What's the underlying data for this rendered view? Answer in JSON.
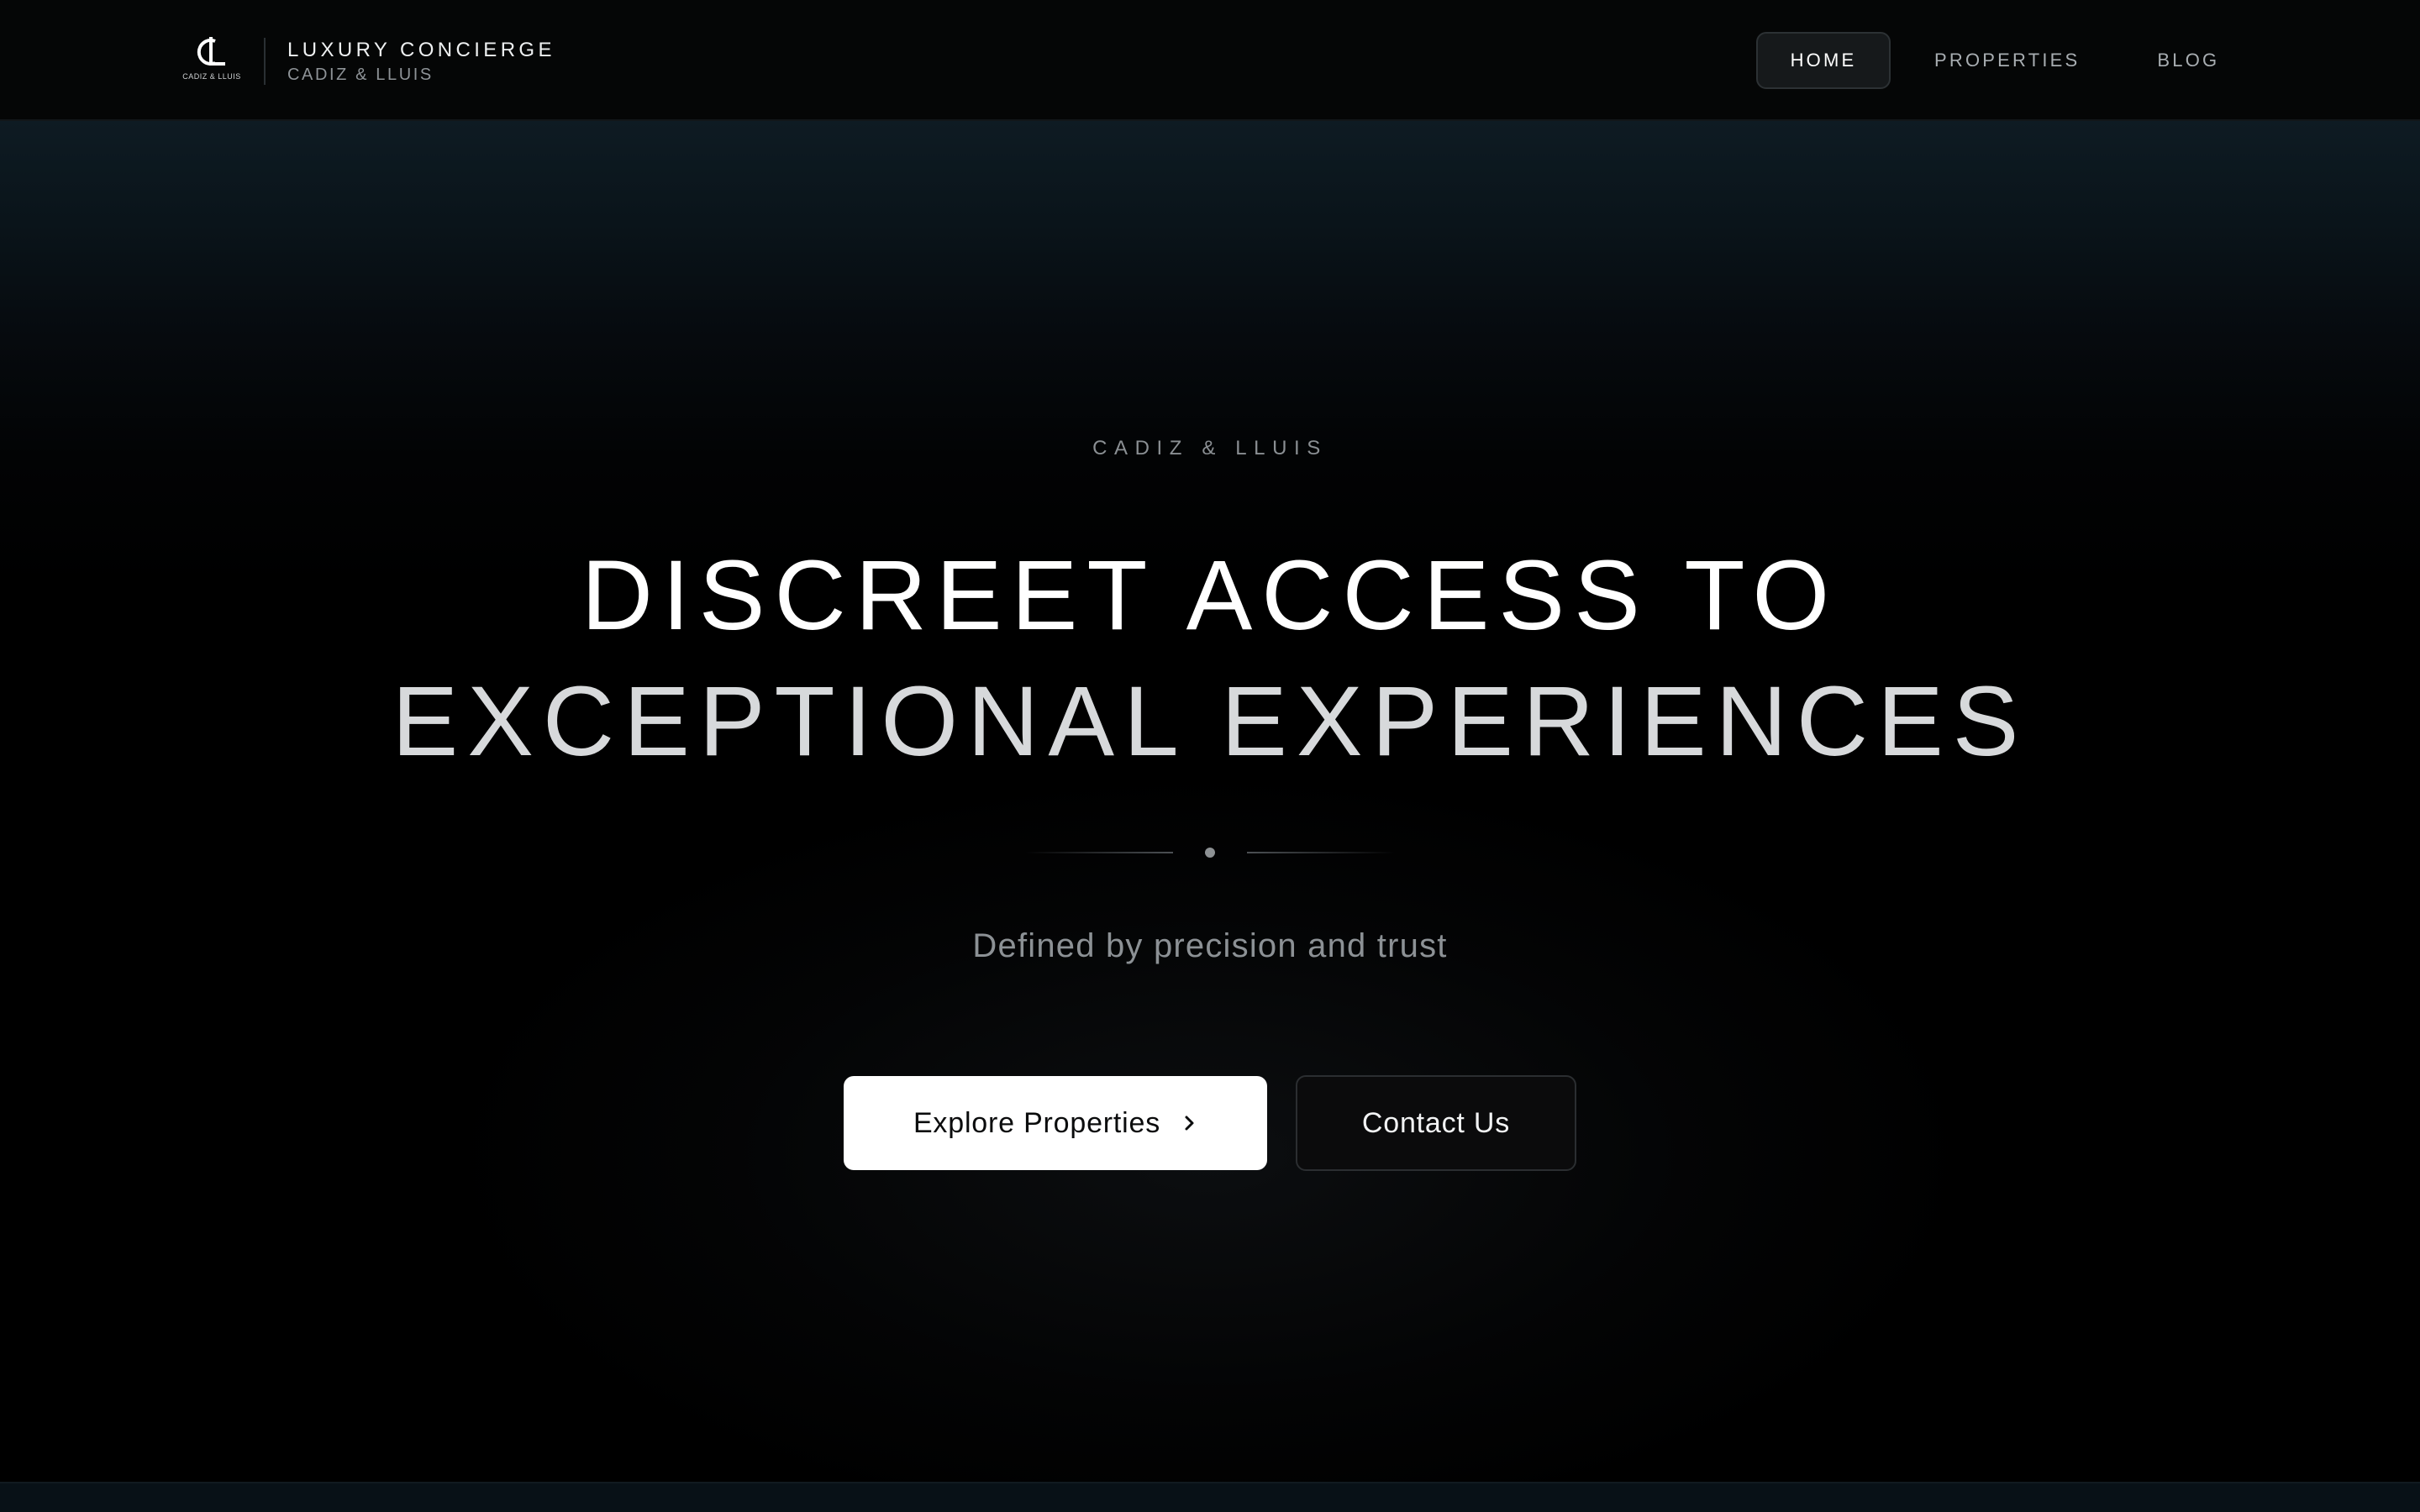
{
  "brand": {
    "logo_letters": "CL",
    "logo_caption": "CADIZ & LLUIS",
    "title": "LUXURY CONCIERGE",
    "subtitle": "CADIZ & LLUIS"
  },
  "nav": {
    "items": [
      {
        "label": "HOME",
        "active": true
      },
      {
        "label": "PROPERTIES",
        "active": false
      },
      {
        "label": "BLOG",
        "active": false
      }
    ]
  },
  "hero": {
    "eyebrow": "CADIZ & LLUIS",
    "headline_line1": "DISCREET ACCESS TO",
    "headline_line2": "EXCEPTIONAL EXPERIENCES",
    "tagline": "Defined by precision and trust",
    "primary_cta": {
      "label": "Explore Properties",
      "icon": "chevron-right-icon"
    },
    "secondary_cta": {
      "label": "Contact Us"
    }
  },
  "colors": {
    "background": "#000000",
    "nav_background": "#050606",
    "hero_top_tint": "#0e1b23",
    "primary_button": "#ffffff",
    "text_primary": "#ffffff",
    "text_muted": "#8c9195"
  }
}
